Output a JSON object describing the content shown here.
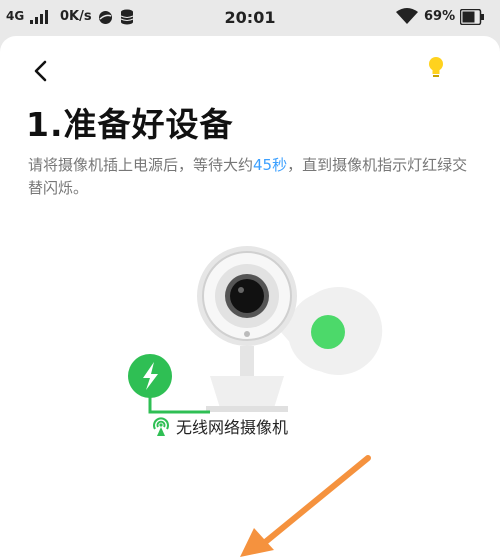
{
  "status_bar": {
    "network": "4G",
    "speed": "0K/s",
    "time": "20:01",
    "battery": "69%"
  },
  "page": {
    "title": "1.准备好设备",
    "description_before": "请将摄像机插上电源后，等待大约",
    "description_highlight": "45秒",
    "description_after": "，直到摄像机指示灯红绿交替闪烁。",
    "device_label": "无线网络摄像机"
  },
  "colors": {
    "green": "#2fbf54",
    "light_green": "#4cd96a",
    "highlight_blue": "#3ca0ff",
    "bulb_yellow": "#ffd21e",
    "arrow_orange": "#f5923e"
  },
  "icons": {
    "back": "chevron-left-icon",
    "tip": "lightbulb-icon",
    "power": "lightning-icon",
    "wireless": "wireless-signal-icon"
  }
}
